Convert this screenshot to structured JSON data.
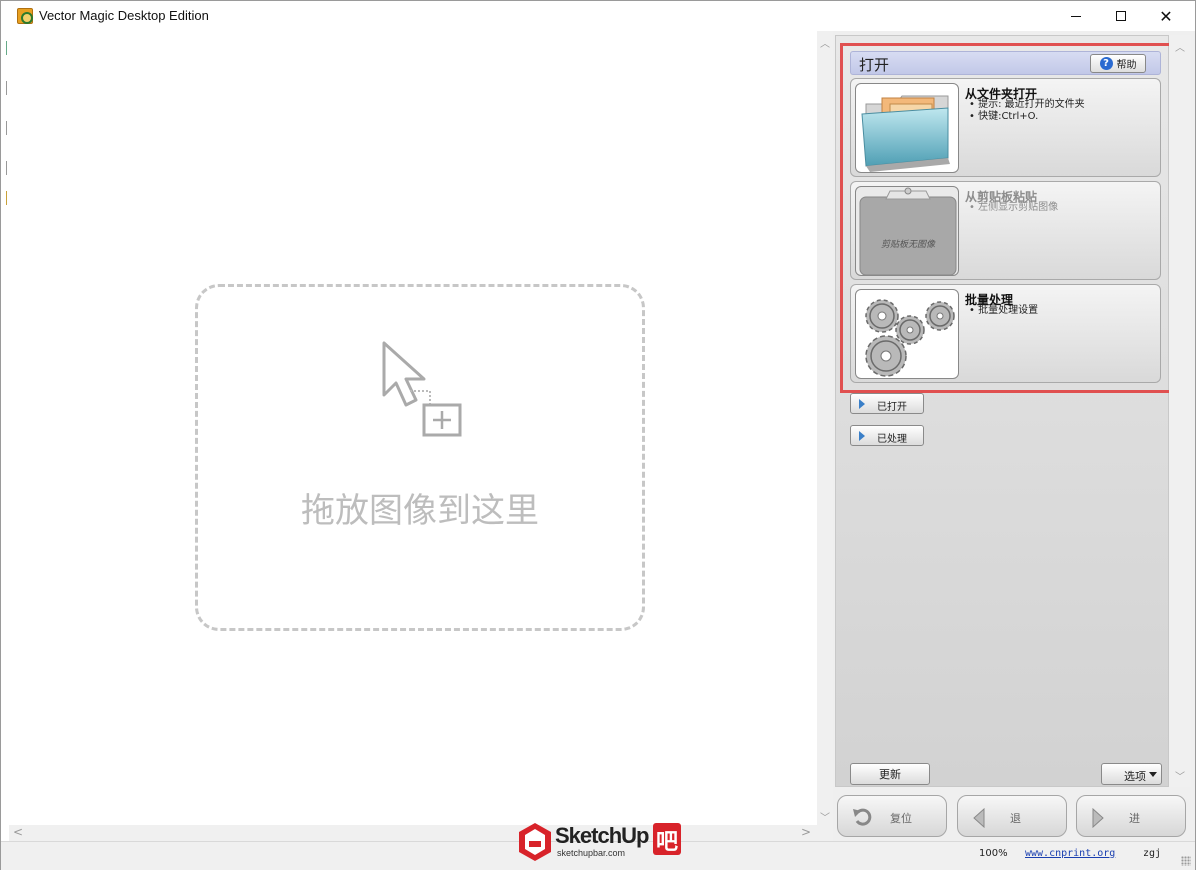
{
  "window": {
    "title": "Vector Magic Desktop Edition",
    "minimize": "minimize",
    "maximize": "maximize",
    "close": "✕"
  },
  "dropzone": {
    "text": "拖放图像到这里"
  },
  "panel": {
    "section_title": "打开",
    "help_label": "帮助",
    "options": [
      {
        "title": "从文件夹打开",
        "bullets": [
          "提示: 最近打开的文件夹",
          "快键:Ctrl+O."
        ]
      },
      {
        "title": "从剪贴板粘贴",
        "bullets": [
          "左侧显示剪贴图像"
        ],
        "image_caption": "剪贴板无图像"
      },
      {
        "title": "批量处理",
        "bullets": [
          "批量处理设置"
        ]
      }
    ],
    "opened_label": "已打开",
    "processed_label": "已处理",
    "update_label": "更新",
    "options_label": "选项",
    "nav": {
      "reset_label": "复位",
      "back_label": "退",
      "forward_label": "进"
    }
  },
  "status": {
    "zoom": "100%",
    "link": "www.cnprint.org",
    "user": "zgj"
  },
  "watermark": {
    "brand": "SketchUp",
    "suffix": "吧",
    "url": "sketchupbar.com"
  },
  "colors": {
    "highlight_frame": "#e05050",
    "header_bg": "#c2c8e8",
    "link": "#1a3fb0",
    "help_icon": "#2a6ad1",
    "watermark_red": "#d8232a"
  }
}
